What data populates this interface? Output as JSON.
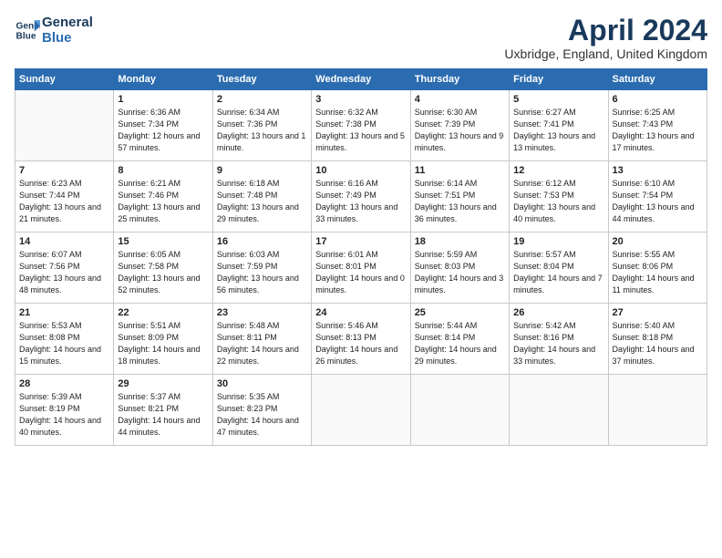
{
  "logo": {
    "line1": "General",
    "line2": "Blue"
  },
  "title": "April 2024",
  "location": "Uxbridge, England, United Kingdom",
  "headers": [
    "Sunday",
    "Monday",
    "Tuesday",
    "Wednesday",
    "Thursday",
    "Friday",
    "Saturday"
  ],
  "weeks": [
    [
      {
        "day": "",
        "sunrise": "",
        "sunset": "",
        "daylight": "",
        "empty": true
      },
      {
        "day": "1",
        "sunrise": "Sunrise: 6:36 AM",
        "sunset": "Sunset: 7:34 PM",
        "daylight": "Daylight: 12 hours and 57 minutes."
      },
      {
        "day": "2",
        "sunrise": "Sunrise: 6:34 AM",
        "sunset": "Sunset: 7:36 PM",
        "daylight": "Daylight: 13 hours and 1 minute."
      },
      {
        "day": "3",
        "sunrise": "Sunrise: 6:32 AM",
        "sunset": "Sunset: 7:38 PM",
        "daylight": "Daylight: 13 hours and 5 minutes."
      },
      {
        "day": "4",
        "sunrise": "Sunrise: 6:30 AM",
        "sunset": "Sunset: 7:39 PM",
        "daylight": "Daylight: 13 hours and 9 minutes."
      },
      {
        "day": "5",
        "sunrise": "Sunrise: 6:27 AM",
        "sunset": "Sunset: 7:41 PM",
        "daylight": "Daylight: 13 hours and 13 minutes."
      },
      {
        "day": "6",
        "sunrise": "Sunrise: 6:25 AM",
        "sunset": "Sunset: 7:43 PM",
        "daylight": "Daylight: 13 hours and 17 minutes."
      }
    ],
    [
      {
        "day": "7",
        "sunrise": "Sunrise: 6:23 AM",
        "sunset": "Sunset: 7:44 PM",
        "daylight": "Daylight: 13 hours and 21 minutes."
      },
      {
        "day": "8",
        "sunrise": "Sunrise: 6:21 AM",
        "sunset": "Sunset: 7:46 PM",
        "daylight": "Daylight: 13 hours and 25 minutes."
      },
      {
        "day": "9",
        "sunrise": "Sunrise: 6:18 AM",
        "sunset": "Sunset: 7:48 PM",
        "daylight": "Daylight: 13 hours and 29 minutes."
      },
      {
        "day": "10",
        "sunrise": "Sunrise: 6:16 AM",
        "sunset": "Sunset: 7:49 PM",
        "daylight": "Daylight: 13 hours and 33 minutes."
      },
      {
        "day": "11",
        "sunrise": "Sunrise: 6:14 AM",
        "sunset": "Sunset: 7:51 PM",
        "daylight": "Daylight: 13 hours and 36 minutes."
      },
      {
        "day": "12",
        "sunrise": "Sunrise: 6:12 AM",
        "sunset": "Sunset: 7:53 PM",
        "daylight": "Daylight: 13 hours and 40 minutes."
      },
      {
        "day": "13",
        "sunrise": "Sunrise: 6:10 AM",
        "sunset": "Sunset: 7:54 PM",
        "daylight": "Daylight: 13 hours and 44 minutes."
      }
    ],
    [
      {
        "day": "14",
        "sunrise": "Sunrise: 6:07 AM",
        "sunset": "Sunset: 7:56 PM",
        "daylight": "Daylight: 13 hours and 48 minutes."
      },
      {
        "day": "15",
        "sunrise": "Sunrise: 6:05 AM",
        "sunset": "Sunset: 7:58 PM",
        "daylight": "Daylight: 13 hours and 52 minutes."
      },
      {
        "day": "16",
        "sunrise": "Sunrise: 6:03 AM",
        "sunset": "Sunset: 7:59 PM",
        "daylight": "Daylight: 13 hours and 56 minutes."
      },
      {
        "day": "17",
        "sunrise": "Sunrise: 6:01 AM",
        "sunset": "Sunset: 8:01 PM",
        "daylight": "Daylight: 14 hours and 0 minutes."
      },
      {
        "day": "18",
        "sunrise": "Sunrise: 5:59 AM",
        "sunset": "Sunset: 8:03 PM",
        "daylight": "Daylight: 14 hours and 3 minutes."
      },
      {
        "day": "19",
        "sunrise": "Sunrise: 5:57 AM",
        "sunset": "Sunset: 8:04 PM",
        "daylight": "Daylight: 14 hours and 7 minutes."
      },
      {
        "day": "20",
        "sunrise": "Sunrise: 5:55 AM",
        "sunset": "Sunset: 8:06 PM",
        "daylight": "Daylight: 14 hours and 11 minutes."
      }
    ],
    [
      {
        "day": "21",
        "sunrise": "Sunrise: 5:53 AM",
        "sunset": "Sunset: 8:08 PM",
        "daylight": "Daylight: 14 hours and 15 minutes."
      },
      {
        "day": "22",
        "sunrise": "Sunrise: 5:51 AM",
        "sunset": "Sunset: 8:09 PM",
        "daylight": "Daylight: 14 hours and 18 minutes."
      },
      {
        "day": "23",
        "sunrise": "Sunrise: 5:48 AM",
        "sunset": "Sunset: 8:11 PM",
        "daylight": "Daylight: 14 hours and 22 minutes."
      },
      {
        "day": "24",
        "sunrise": "Sunrise: 5:46 AM",
        "sunset": "Sunset: 8:13 PM",
        "daylight": "Daylight: 14 hours and 26 minutes."
      },
      {
        "day": "25",
        "sunrise": "Sunrise: 5:44 AM",
        "sunset": "Sunset: 8:14 PM",
        "daylight": "Daylight: 14 hours and 29 minutes."
      },
      {
        "day": "26",
        "sunrise": "Sunrise: 5:42 AM",
        "sunset": "Sunset: 8:16 PM",
        "daylight": "Daylight: 14 hours and 33 minutes."
      },
      {
        "day": "27",
        "sunrise": "Sunrise: 5:40 AM",
        "sunset": "Sunset: 8:18 PM",
        "daylight": "Daylight: 14 hours and 37 minutes."
      }
    ],
    [
      {
        "day": "28",
        "sunrise": "Sunrise: 5:39 AM",
        "sunset": "Sunset: 8:19 PM",
        "daylight": "Daylight: 14 hours and 40 minutes."
      },
      {
        "day": "29",
        "sunrise": "Sunrise: 5:37 AM",
        "sunset": "Sunset: 8:21 PM",
        "daylight": "Daylight: 14 hours and 44 minutes."
      },
      {
        "day": "30",
        "sunrise": "Sunrise: 5:35 AM",
        "sunset": "Sunset: 8:23 PM",
        "daylight": "Daylight: 14 hours and 47 minutes."
      },
      {
        "day": "",
        "sunrise": "",
        "sunset": "",
        "daylight": "",
        "empty": true
      },
      {
        "day": "",
        "sunrise": "",
        "sunset": "",
        "daylight": "",
        "empty": true
      },
      {
        "day": "",
        "sunrise": "",
        "sunset": "",
        "daylight": "",
        "empty": true
      },
      {
        "day": "",
        "sunrise": "",
        "sunset": "",
        "daylight": "",
        "empty": true
      }
    ]
  ]
}
